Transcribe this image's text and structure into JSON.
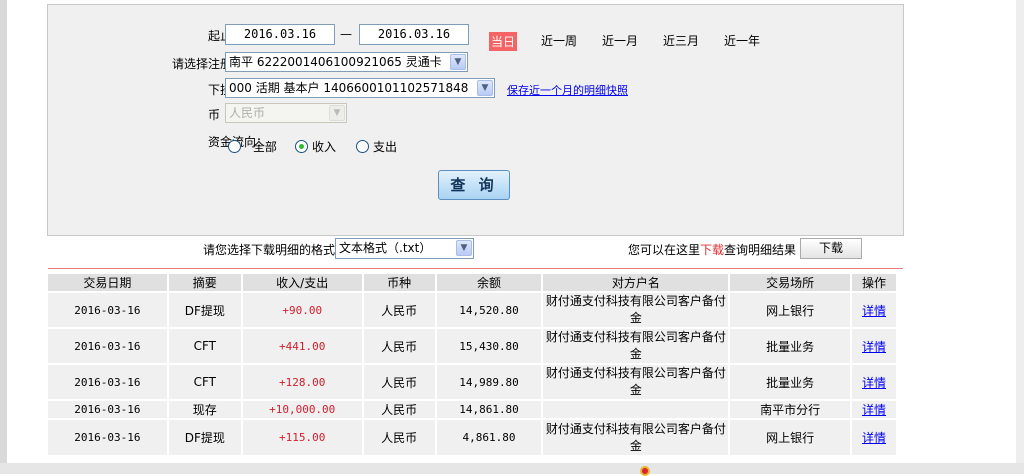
{
  "query": {
    "date_label": "起止日期：",
    "date_from": "2016.03.16",
    "date_sep": "—",
    "date_to": "2016.03.16",
    "quick": [
      "当日",
      "近一周",
      "近一月",
      "近三月",
      "近一年"
    ],
    "account_label": "请选择注册账户：",
    "account_value": "南平 6222001406100921065 灵通卡",
    "sub_label": "下挂账户：",
    "sub_value": "000 活期 基本户 1406600101102571848",
    "snapshot_link": "保存近一个月的明细快照",
    "currency_label": "币　　种：",
    "currency_value": "人民币",
    "flow_label": "资金流向：",
    "flow_options": [
      "全部",
      "收入",
      "支出"
    ],
    "flow_selected": "收入",
    "query_button": "查 询"
  },
  "download": {
    "format_label": "请您选择下载明细的格式",
    "format_value": "文本格式（.txt）",
    "hint_pre": "您可以在这里",
    "hint_red": "下载",
    "hint_post": "查询明细结果",
    "button": "下载"
  },
  "colors": {
    "accent_red": "#f46464",
    "amount_red": "#d0202e"
  },
  "table": {
    "headers": [
      "交易日期",
      "摘要",
      "收入/支出",
      "币种",
      "余额",
      "对方户名",
      "交易场所",
      "操作"
    ],
    "rows": [
      [
        "2016-03-16",
        "DF提现",
        "+90.00",
        "人民币",
        "14,520.80",
        "财付通支付科技有限公司客户备付金",
        "网上银行",
        "详情"
      ],
      [
        "2016-03-16",
        "CFT",
        "+441.00",
        "人民币",
        "15,430.80",
        "财付通支付科技有限公司客户备付金",
        "批量业务",
        "详情"
      ],
      [
        "2016-03-16",
        "CFT",
        "+128.00",
        "人民币",
        "14,989.80",
        "财付通支付科技有限公司客户备付金",
        "批量业务",
        "详情"
      ],
      [
        "2016-03-16",
        "现存",
        "+10,000.00",
        "人民币",
        "14,861.80",
        "",
        "南平市分行",
        "详情"
      ],
      [
        "2016-03-16",
        "DF提现",
        "+115.00",
        "人民币",
        "4,861.80",
        "财付通支付科技有限公司客户备付金",
        "网上银行",
        "详情"
      ]
    ]
  }
}
